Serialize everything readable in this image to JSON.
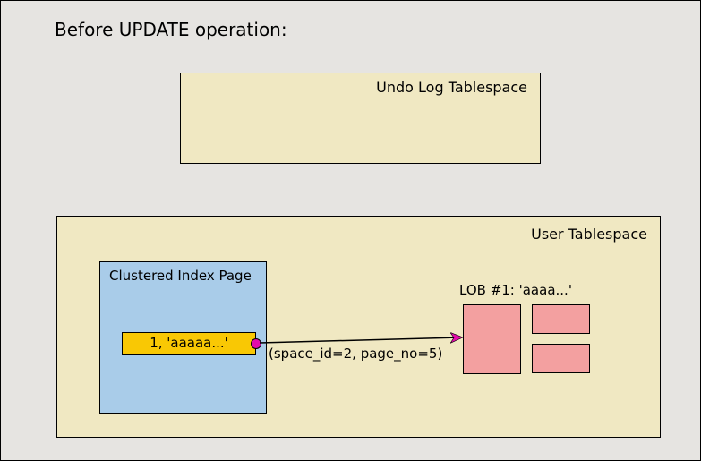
{
  "title": "Before UPDATE operation:",
  "undo_log": {
    "label": "Undo Log Tablespace"
  },
  "user_ts": {
    "label": "User Tablespace",
    "index_page": {
      "label": "Clustered Index Page",
      "record": "1, 'aaaaa...'"
    },
    "lob": {
      "label": "LOB #1: 'aaaa...'"
    },
    "ref": {
      "text": "(space_id=2, page_no=5)"
    }
  },
  "chart_data": {
    "type": "diagram",
    "title": "Before UPDATE operation",
    "containers": [
      {
        "name": "Undo Log Tablespace",
        "children": []
      },
      {
        "name": "User Tablespace",
        "children": [
          {
            "name": "Clustered Index Page",
            "records": [
              "1, 'aaaaa...'"
            ]
          },
          {
            "name": "LOB #1: 'aaaa...'",
            "blocks": 3
          }
        ]
      }
    ],
    "edges": [
      {
        "from": "Clustered Index Page record",
        "to": "LOB #1",
        "label": "(space_id=2, page_no=5)"
      }
    ]
  }
}
